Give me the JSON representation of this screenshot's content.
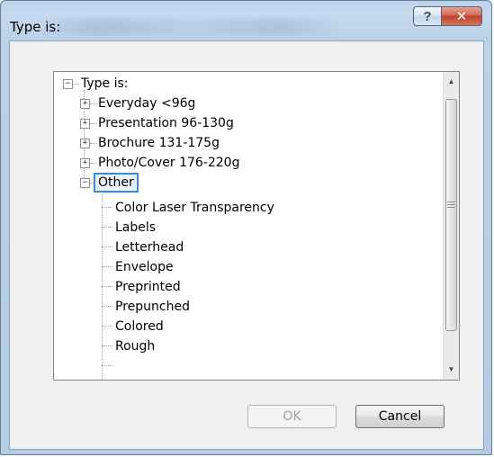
{
  "window": {
    "title": "Type is:"
  },
  "titlebar_buttons": {
    "help_symbol": "?",
    "close_symbol": "✕"
  },
  "tree": {
    "root": {
      "label": "Type is:",
      "expander": "−"
    },
    "groups": [
      {
        "label": "Everyday <96g",
        "expander": "+"
      },
      {
        "label": "Presentation 96-130g",
        "expander": "+"
      },
      {
        "label": "Brochure 131-175g",
        "expander": "+"
      },
      {
        "label": "Photo/Cover 176-220g",
        "expander": "+"
      },
      {
        "label": "Other",
        "expander": "−",
        "selected": true
      }
    ],
    "other_children": [
      {
        "label": "Color Laser Transparency"
      },
      {
        "label": "Labels"
      },
      {
        "label": "Letterhead"
      },
      {
        "label": "Envelope"
      },
      {
        "label": "Preprinted"
      },
      {
        "label": "Prepunched"
      },
      {
        "label": "Colored"
      },
      {
        "label": "Rough"
      }
    ]
  },
  "scrollbar": {
    "up_arrow": "▲",
    "down_arrow": "▼"
  },
  "buttons": {
    "ok": "OK",
    "cancel": "Cancel"
  },
  "colors": {
    "selection_border": "#3c8bd9",
    "close_button": "#c0412a"
  }
}
